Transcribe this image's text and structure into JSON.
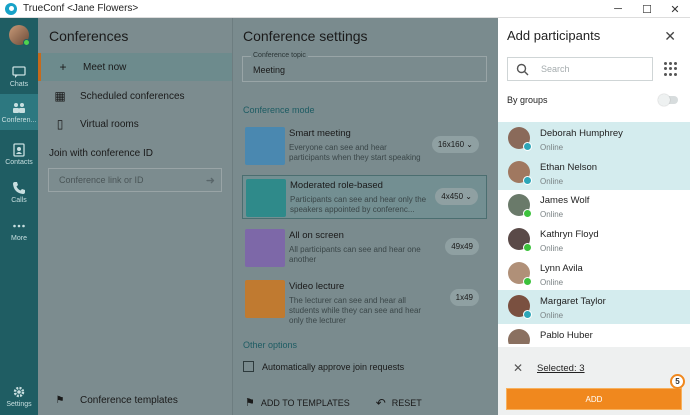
{
  "window": {
    "title": "TrueConf <Jane Flowers>",
    "controls": [
      "─",
      "☐",
      "✕"
    ]
  },
  "nav": {
    "items": [
      {
        "label": "Chats",
        "icon": "chat-icon"
      },
      {
        "label": "Conferen...",
        "icon": "conferences-icon",
        "active": true
      },
      {
        "label": "Contacts",
        "icon": "contacts-icon"
      },
      {
        "label": "Calls",
        "icon": "phone-icon"
      },
      {
        "label": "More",
        "icon": "more-icon"
      },
      {
        "label": "Settings",
        "icon": "gear-icon"
      }
    ]
  },
  "conferences": {
    "title": "Conferences",
    "menu": [
      {
        "label": "Meet now",
        "icon": "plus-icon"
      },
      {
        "label": "Scheduled conferences",
        "icon": "calendar-icon"
      },
      {
        "label": "Virtual rooms",
        "icon": "door-icon"
      }
    ],
    "join_label": "Join with conference ID",
    "join_placeholder": "Conference link or ID",
    "templates_label": "Conference templates"
  },
  "settings": {
    "title": "Conference settings",
    "topic_label": "Conference topic",
    "topic_value": "Meeting",
    "mode_label": "Conference mode",
    "modes": [
      {
        "title": "Smart meeting",
        "desc": "Everyone can see and hear participants when they start speaking",
        "size": "16x160 ⌄",
        "color": "#4a88b0"
      },
      {
        "title": "Moderated role-based",
        "desc": "Participants can see and hear only the speakers appointed by conferenc...",
        "size": "4x450 ⌄",
        "color": "#2f8a8a"
      },
      {
        "title": "All on screen",
        "desc": "All participants can see and hear one another",
        "size": "49x49",
        "color": "#7d68a8"
      },
      {
        "title": "Video lecture",
        "desc": "The lecturer can see and hear all students while they can see and hear only the lecturer",
        "size": "1x49",
        "color": "#c07a30"
      }
    ],
    "other_label": "Other options",
    "auto_approve": "Automatically approve join requests",
    "add_templates": "ADD TO TEMPLATES",
    "reset": "RESET"
  },
  "add_participants": {
    "title": "Add participants",
    "search_placeholder": "Search",
    "by_groups": "By groups",
    "participants": [
      {
        "name": "Deborah Humphrey",
        "status": "Online",
        "selected": true,
        "avatar": "#8a6a5a"
      },
      {
        "name": "Ethan Nelson",
        "status": "Online",
        "selected": true,
        "avatar": "#a07860"
      },
      {
        "name": "James Wolf",
        "status": "Online",
        "selected": false,
        "avatar": "#6a7a6a"
      },
      {
        "name": "Kathryn Floyd",
        "status": "Online",
        "selected": false,
        "avatar": "#5a4a48"
      },
      {
        "name": "Lynn Avila",
        "status": "Online",
        "selected": false,
        "avatar": "#b09078"
      },
      {
        "name": "Margaret Taylor",
        "status": "Online",
        "selected": true,
        "avatar": "#7a5040"
      },
      {
        "name": "Pablo Huber",
        "status": "Online",
        "selected": false,
        "avatar": "#8a7060"
      }
    ],
    "selected_text": "Selected: 3",
    "add_button": "ADD",
    "step_badge": "5"
  }
}
